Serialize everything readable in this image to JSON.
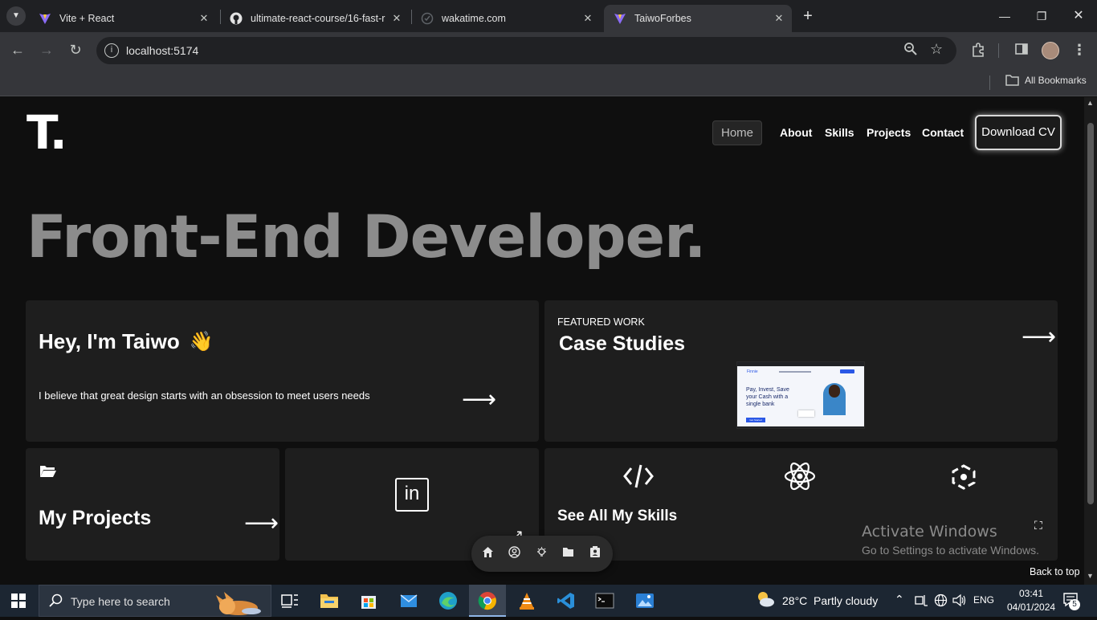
{
  "browser": {
    "tabs": [
      {
        "title": "Vite + React",
        "active": false
      },
      {
        "title": "ultimate-react-course/16-fast-r",
        "active": false
      },
      {
        "title": "wakatime.com",
        "active": false
      },
      {
        "title": "TaiwoForbes",
        "active": true
      }
    ],
    "url": "localhost:5174",
    "bookmarks_label": "All Bookmarks"
  },
  "site": {
    "logo": "T.",
    "nav": {
      "home": "Home",
      "about": "About",
      "skills": "Skills",
      "projects": "Projects",
      "contact": "Contact",
      "download_cv": "Download CV"
    },
    "hero_title": "Front-End Developer.",
    "intro_card": {
      "greeting": "Hey, I'm Taiwo",
      "emoji": "👋",
      "tagline": "I believe that great design starts with an obsession to meet users needs"
    },
    "featured_card": {
      "eyebrow": "FEATURED WORK",
      "title": "Case Studies",
      "preview": {
        "brand": "Finnie",
        "headline": "Pay, Invest, Save your Cash with a single bank",
        "cta": "Get Started"
      }
    },
    "projects_card": {
      "title": "My Projects"
    },
    "linkedin_card": {
      "icon_label": "in"
    },
    "skills_card": {
      "title": "See All My Skills"
    },
    "back_to_top": "Back to top",
    "watermark": {
      "title": "Activate Windows",
      "subtitle": "Go to Settings to activate Windows."
    }
  },
  "taskbar": {
    "search_placeholder": "Type here to search",
    "weather": "28°C  Partly cloudy",
    "language": "ENG",
    "time": "03:41",
    "date": "04/01/2024",
    "notification_count": "5"
  },
  "colors": {
    "page_bg": "#0f0f0f",
    "card_bg": "#1e1e1e",
    "hero_text": "#8c8c8c",
    "taskbar_bg": "#1c2632",
    "chrome_bg": "#35363a"
  }
}
